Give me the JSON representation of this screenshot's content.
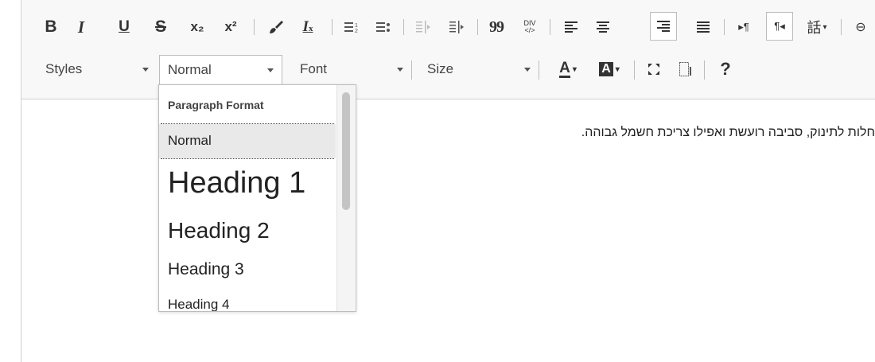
{
  "toolbar": {
    "row1": [
      {
        "name": "bold-button",
        "icon": "bold-icon",
        "text": "B"
      },
      {
        "name": "italic-button",
        "icon": "italic-icon",
        "text": "I"
      },
      {
        "name": "underline-button",
        "icon": "underline-icon",
        "text": "U"
      },
      {
        "name": "strikethrough-button",
        "icon": "strikethrough-icon",
        "text": "S"
      },
      {
        "name": "subscript-button",
        "icon": "subscript-icon",
        "text": "x₂"
      },
      {
        "name": "superscript-button",
        "icon": "superscript-icon",
        "text": "x²"
      },
      {
        "name": "copy-formatting-button",
        "icon": "paintbrush-icon"
      },
      {
        "name": "remove-format-button",
        "icon": "remove-format-icon",
        "text": "I"
      },
      {
        "name": "numbered-list-button",
        "icon": "numbered-list-icon"
      },
      {
        "name": "bulleted-list-button",
        "icon": "bulleted-list-icon"
      },
      {
        "name": "decrease-indent-button",
        "icon": "outdent-icon"
      },
      {
        "name": "increase-indent-button",
        "icon": "indent-icon"
      },
      {
        "name": "blockquote-button",
        "icon": "quote-icon",
        "text": "99"
      },
      {
        "name": "create-div-button",
        "icon": "div-icon",
        "text": "DIV"
      },
      {
        "name": "align-left-button",
        "icon": "align-left-icon"
      },
      {
        "name": "align-center-button",
        "icon": "align-center-icon"
      },
      {
        "name": "align-right-button",
        "icon": "align-right-icon"
      },
      {
        "name": "justify-button",
        "icon": "justify-icon"
      },
      {
        "name": "ltr-button",
        "icon": "ltr-icon",
        "text": "▸¶"
      },
      {
        "name": "rtl-button",
        "icon": "rtl-icon",
        "text": "¶◂"
      },
      {
        "name": "language-button",
        "icon": "language-icon",
        "text": "話"
      },
      {
        "name": "link-button",
        "icon": "link-icon",
        "text": "⊖"
      }
    ],
    "styles_label": "Styles",
    "format_label": "Normal",
    "font_label": "Font",
    "size_label": "Size",
    "text_color_label": "A",
    "bg_color_label": "A",
    "help_label": "?",
    "colors": {
      "toolbar_bg": "#f8f8f8",
      "border": "#d1d1d1",
      "active_bg": "#ffffff",
      "selected_bg": "#e9e9e9"
    }
  },
  "format_menu": {
    "title": "Paragraph Format",
    "options": [
      {
        "label": "Normal",
        "selected": true
      },
      {
        "label": "Heading 1",
        "selected": false
      },
      {
        "label": "Heading 2",
        "selected": false
      },
      {
        "label": "Heading 3",
        "selected": false
      },
      {
        "label": "Heading 4",
        "selected": false
      }
    ]
  },
  "content": {
    "text": "חלות לתינוק, סביבה רועשת ואפילו צריכת חשמל גבוהה."
  }
}
